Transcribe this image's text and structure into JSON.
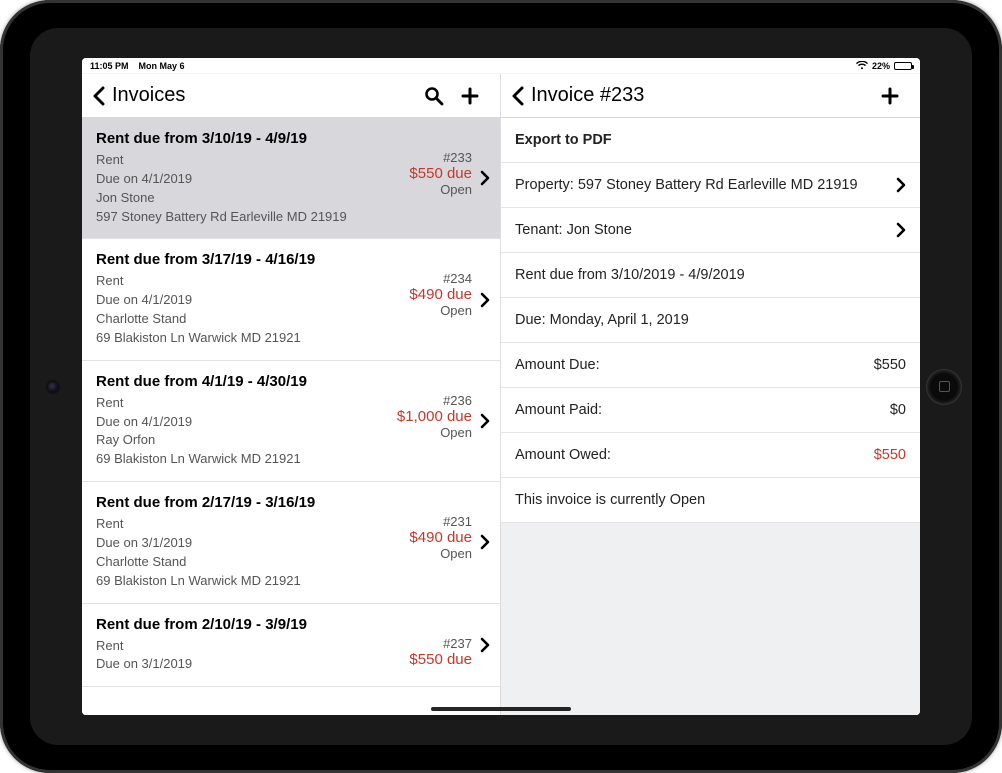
{
  "status_bar": {
    "time": "11:05 PM",
    "date": "Mon May 6",
    "battery_pct": "22%"
  },
  "left": {
    "title": "Invoices",
    "items": [
      {
        "title": "Rent due from 3/10/19 - 4/9/19",
        "category": "Rent",
        "due": "Due on 4/1/2019",
        "tenant": "Jon Stone",
        "address": "597 Stoney Battery Rd Earleville MD 21919",
        "number": "#233",
        "amount": "$550 due",
        "status": "Open",
        "selected": true
      },
      {
        "title": "Rent due from 3/17/19 - 4/16/19",
        "category": "Rent",
        "due": "Due on 4/1/2019",
        "tenant": "Charlotte Stand",
        "address": "69 Blakiston Ln Warwick MD 21921",
        "number": "#234",
        "amount": "$490 due",
        "status": "Open",
        "selected": false
      },
      {
        "title": "Rent due from 4/1/19 - 4/30/19",
        "category": "Rent",
        "due": "Due on 4/1/2019",
        "tenant": "Ray Orfon",
        "address": "69 Blakiston Ln Warwick MD 21921",
        "number": "#236",
        "amount": "$1,000 due",
        "status": "Open",
        "selected": false
      },
      {
        "title": "Rent due from 2/17/19 - 3/16/19",
        "category": "Rent",
        "due": "Due on 3/1/2019",
        "tenant": "Charlotte Stand",
        "address": "69 Blakiston Ln Warwick MD 21921",
        "number": "#231",
        "amount": "$490 due",
        "status": "Open",
        "selected": false
      },
      {
        "title": "Rent due from 2/10/19 - 3/9/19",
        "category": "Rent",
        "due": "Due on 3/1/2019",
        "tenant": "",
        "address": "",
        "number": "#237",
        "amount": "$550 due",
        "status": "",
        "selected": false
      }
    ]
  },
  "right": {
    "title": "Invoice #233",
    "export_label": "Export to PDF",
    "property_label": "Property: 597 Stoney Battery Rd Earleville MD 21919",
    "tenant_label": "Tenant: Jon Stone",
    "period_label": "Rent due from 3/10/2019 - 4/9/2019",
    "due_label": "Due: Monday, April 1, 2019",
    "amount_due_label": "Amount Due:",
    "amount_due_value": "$550",
    "amount_paid_label": "Amount Paid:",
    "amount_paid_value": "$0",
    "amount_owed_label": "Amount Owed:",
    "amount_owed_value": "$550",
    "status_text": "This invoice is currently Open"
  }
}
